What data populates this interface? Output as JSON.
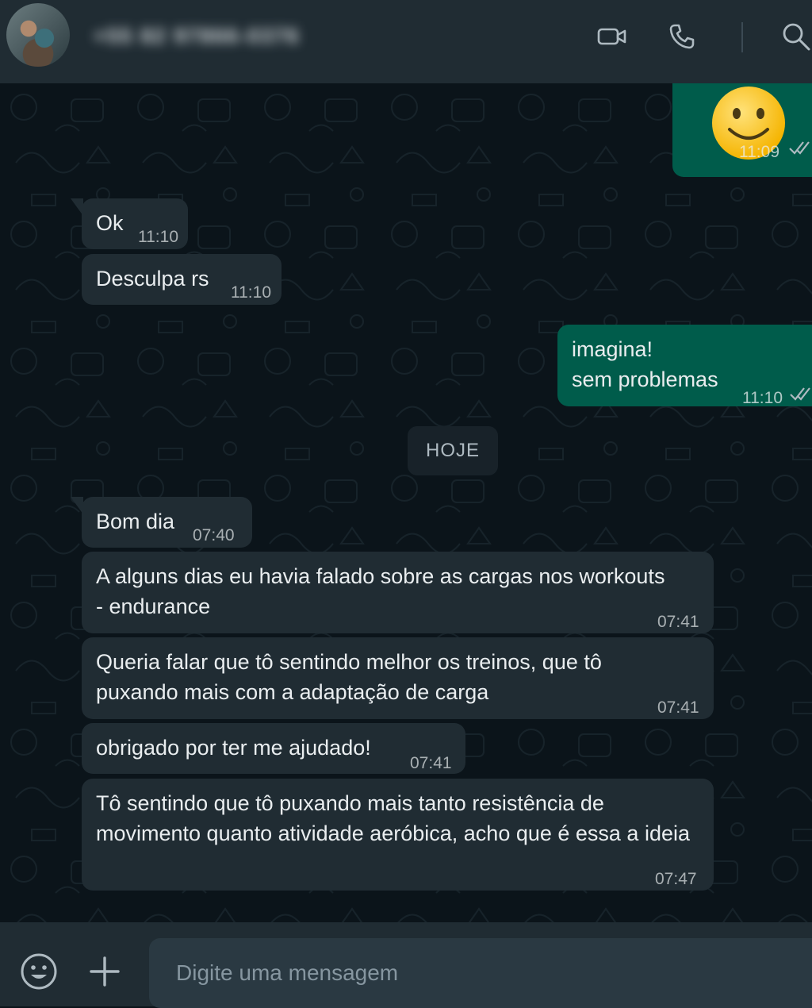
{
  "header": {
    "contact_name": "+55 82 97866-0376",
    "icons": [
      "video-call-icon",
      "phone-call-icon",
      "search-icon"
    ]
  },
  "chat": {
    "day_separator": "HOJE",
    "messages": [
      {
        "dir": "out",
        "text": "🙂",
        "time": "11:09",
        "status": "read"
      },
      {
        "dir": "in",
        "text": "Ok",
        "time": "11:10"
      },
      {
        "dir": "in",
        "text": "Desculpa rs",
        "time": "11:10"
      },
      {
        "dir": "out",
        "text": "imagina!\nsem problemas",
        "time": "11:10",
        "status": "read"
      },
      {
        "dir": "in",
        "text": "Bom dia",
        "time": "07:40"
      },
      {
        "dir": "in",
        "text": "A alguns dias eu havia falado sobre as cargas nos workouts - endurance",
        "time": "07:41"
      },
      {
        "dir": "in",
        "text": "Queria falar que tô sentindo melhor os treinos, que tô puxando mais com a adaptação de carga",
        "time": "07:41"
      },
      {
        "dir": "in",
        "text": "obrigado por ter me ajudado!",
        "time": "07:41"
      },
      {
        "dir": "in",
        "text": "Tô sentindo que tô puxando mais tanto resistência de movimento quanto atividade aeróbica, acho que é essa a ideia",
        "time": "07:47"
      }
    ]
  },
  "footer": {
    "placeholder": "Digite uma mensagem"
  },
  "colors": {
    "background": "#0b141a",
    "panel": "#202c33",
    "incoming_bubble": "#202c33",
    "outgoing_bubble": "#005c4b",
    "text": "#e9edef",
    "secondary_text": "#8696a0"
  }
}
